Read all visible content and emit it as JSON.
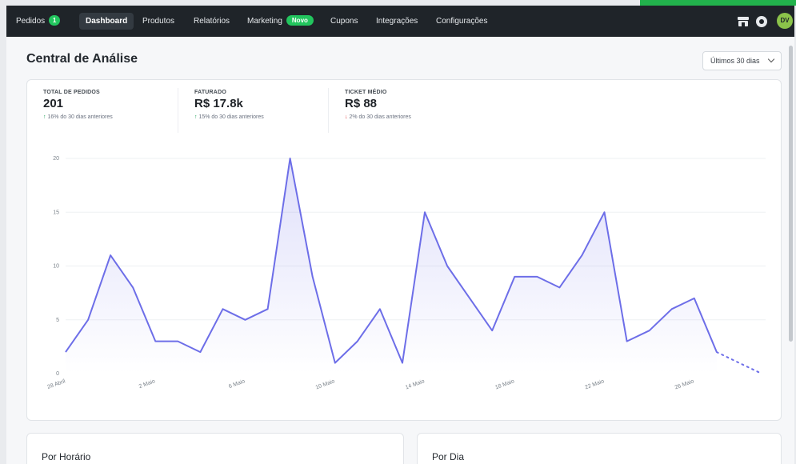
{
  "nav": {
    "items": [
      {
        "label": "Pedidos",
        "badge": "1"
      },
      {
        "label": "Dashboard"
      },
      {
        "label": "Produtos"
      },
      {
        "label": "Relatórios"
      },
      {
        "label": "Marketing",
        "badge": "Novo"
      },
      {
        "label": "Cupons"
      },
      {
        "label": "Integrações"
      },
      {
        "label": "Configurações"
      }
    ],
    "icons": [
      "store-icon",
      "support-icon"
    ],
    "avatar_initials": "DV"
  },
  "page": {
    "title": "Central de Análise",
    "range_select": "Últimos 30 dias"
  },
  "stats": [
    {
      "label": "TOTAL DE PEDIDOS",
      "value": "201",
      "delta_arrow": "↑",
      "delta": "16% do 30 dias anteriores",
      "trend": "up"
    },
    {
      "label": "FATURADO",
      "value": "R$ 17.8k",
      "delta_arrow": "↑",
      "delta": "15% do 30 dias anteriores",
      "trend": "up"
    },
    {
      "label": "TICKET MÉDIO",
      "value": "R$ 88",
      "delta_arrow": "↓",
      "delta": "2% do 30 dias anteriores",
      "trend": "down"
    }
  ],
  "chart_data": {
    "type": "area",
    "x": [
      "28 Abril",
      "29 Abril",
      "30 Abril",
      "1 Maio",
      "2 Maio",
      "3 Maio",
      "4 Maio",
      "5 Maio",
      "6 Maio",
      "7 Maio",
      "8 Maio",
      "9 Maio",
      "10 Maio",
      "11 Maio",
      "12 Maio",
      "13 Maio",
      "14 Maio",
      "15 Maio",
      "16 Maio",
      "17 Maio",
      "18 Maio",
      "19 Maio",
      "20 Maio",
      "21 Maio",
      "22 Maio",
      "23 Maio",
      "24 Maio",
      "25 Maio",
      "26 Maio",
      "27 Maio",
      "28 Maio",
      "29 Maio"
    ],
    "values": [
      2,
      5,
      11,
      8,
      3,
      3,
      2,
      6,
      5,
      6,
      20,
      9,
      1,
      3,
      6,
      1,
      15,
      10,
      7,
      4,
      9,
      9,
      8,
      11,
      15,
      3,
      4,
      6,
      7,
      2,
      1,
      0
    ],
    "projected_from_index": 29,
    "x_tick_labels": [
      "28 Abril",
      "2 Maio",
      "6 Maio",
      "10 Maio",
      "14 Maio",
      "18 Maio",
      "22 Maio",
      "26 Maio"
    ],
    "x_tick_indices": [
      0,
      4,
      8,
      12,
      16,
      20,
      24,
      28
    ],
    "y_ticks": [
      0,
      5,
      10,
      15,
      20
    ],
    "ylim": [
      0,
      20
    ],
    "grid": true,
    "line_color": "#6d6ee8",
    "fill_color": "#6d6ee8"
  },
  "sections": {
    "hourly_title": "Por Horário",
    "daily_title": "Por Dia"
  },
  "colors": {
    "nav_bg": "#1f2429",
    "accent_green": "#22c55e",
    "up": "#22a35a",
    "down": "#e23b3b"
  }
}
